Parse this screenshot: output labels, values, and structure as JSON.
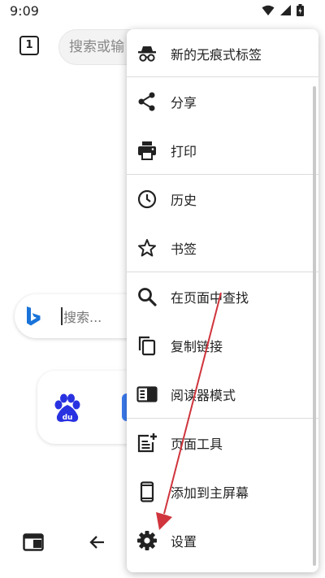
{
  "status_bar": {
    "time": "9:09"
  },
  "toolbar": {
    "tab_count": "1",
    "address_placeholder": "搜索或输"
  },
  "search": {
    "placeholder": "搜索..."
  },
  "menu": {
    "items": [
      {
        "label": "新的无痕式标签",
        "icon": "incognito-icon"
      },
      {
        "label": "分享",
        "icon": "share-icon"
      },
      {
        "label": "打印",
        "icon": "print-icon"
      },
      {
        "label": "历史",
        "icon": "history-icon"
      },
      {
        "label": "书签",
        "icon": "star-icon"
      },
      {
        "label": "在页面中查找",
        "icon": "search-icon"
      },
      {
        "label": "复制链接",
        "icon": "copy-icon"
      },
      {
        "label": "阅读器模式",
        "icon": "reader-mode-icon"
      },
      {
        "label": "页面工具",
        "icon": "page-tools-icon"
      },
      {
        "label": "添加到主屏幕",
        "icon": "phone-icon"
      },
      {
        "label": "设置",
        "icon": "gear-icon"
      }
    ]
  },
  "colors": {
    "annotation_arrow": "#d0343c",
    "bing_blue": "#1a73d9",
    "baidu_blue": "#2932e1"
  }
}
